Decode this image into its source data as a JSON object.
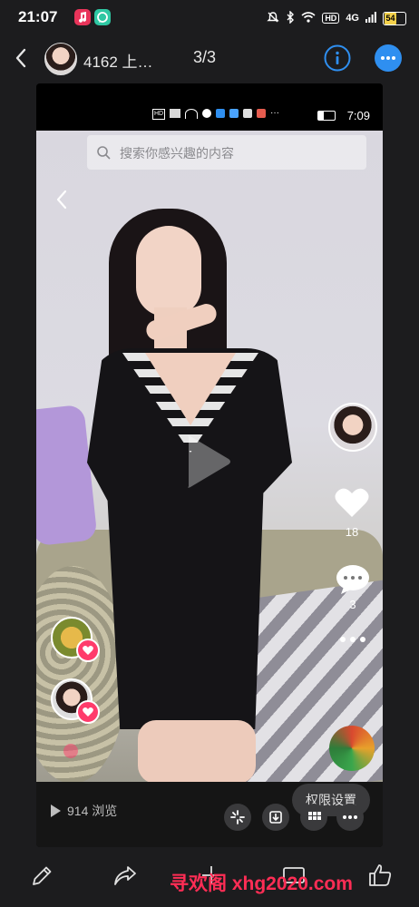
{
  "status_bar": {
    "time": "21:07",
    "network_badge": "4G",
    "battery": "54",
    "hd_badge": "HD"
  },
  "header": {
    "title": "4162 上…",
    "counter": "3/3"
  },
  "embedded_screenshot": {
    "status_time": "7:09",
    "search_placeholder": "搜索你感兴趣的内容",
    "likes": "18",
    "comments": "3",
    "views": "914 浏览",
    "permission_button": "权限设置"
  },
  "watermark": "寻欢阁 xhg2020.com",
  "colors": {
    "accent_blue": "#2f8ff0",
    "like_red": "#ff3b6b",
    "watermark": "#ff2d55"
  }
}
